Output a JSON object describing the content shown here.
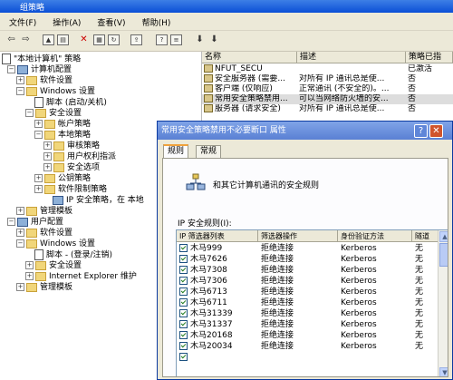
{
  "window": {
    "title": "组策略"
  },
  "menu": [
    "文件(F)",
    "操作(A)",
    "查看(V)",
    "帮助(H)"
  ],
  "toolbar": {
    "icons": [
      "back-arrow-icon",
      "forward-arrow-icon",
      "up-folder-icon",
      "show-tree-icon",
      "delete-icon",
      "properties-icon",
      "refresh-icon",
      "export-icon",
      "help-icon",
      "filter-icon",
      "assign-icon",
      "unassign-icon"
    ]
  },
  "tree": {
    "root": "\"本地计算机\" 策略",
    "computer_config": "计算机配置",
    "software_settings": "软件设置",
    "windows_settings": "Windows 设置",
    "scripts_startup": "脚本 (启动/关机)",
    "security_settings": "安全设置",
    "account_policies": "帐户策略",
    "local_policies": "本地策略",
    "audit_policy": "审核策略",
    "user_rights": "用户权利指派",
    "security_options": "安全选项",
    "public_key": "公钥策略",
    "software_restriction": "软件限制策略",
    "ip_security": "IP 安全策略，在 本地",
    "admin_templates": "管理模板",
    "user_config": "用户配置",
    "u_software_settings": "软件设置",
    "u_windows_settings": "Windows 设置",
    "u_scripts_logon": "脚本 - (登录/注销)",
    "u_security_settings": "安全设置",
    "u_ie_maintenance": "Internet Explorer 维护",
    "u_admin_templates": "管理模板"
  },
  "policy_list": {
    "headers": [
      "名称",
      "描述",
      "策略已指"
    ],
    "rows": [
      {
        "name": "NFUT_SECU",
        "desc": "",
        "assigned": "已激活"
      },
      {
        "name": "安全服务器 (需要...",
        "desc": "对所有 IP 通讯总是使...",
        "assigned": "否"
      },
      {
        "name": "客户端 (仅响应)",
        "desc": "正常通讯 (不安全的)。...",
        "assigned": "否"
      },
      {
        "name": "常用安全策略禁用...",
        "desc": "可以当网络防火墙的安...",
        "assigned": "否"
      },
      {
        "name": "服务器 (请求安全)",
        "desc": "对所有 IP 通讯总是使...",
        "assigned": "否"
      }
    ]
  },
  "dialog": {
    "title": "常用安全策略禁用不必要断口 属性",
    "help_button": "?",
    "close_button": "✕",
    "tabs": [
      "规则",
      "常规"
    ],
    "description": "和其它计算机通讯的安全规则",
    "rules_label": "IP 安全规则(I):",
    "columns": [
      "IP 筛选器列表",
      "筛选器操作",
      "身份验证方法",
      "隧道"
    ],
    "rules": [
      {
        "filter": "木马999",
        "action": "拒绝连接",
        "auth": "Kerberos",
        "tunnel": "无"
      },
      {
        "filter": "木马7626",
        "action": "拒绝连接",
        "auth": "Kerberos",
        "tunnel": "无"
      },
      {
        "filter": "木马7308",
        "action": "拒绝连接",
        "auth": "Kerberos",
        "tunnel": "无"
      },
      {
        "filter": "木马7306",
        "action": "拒绝连接",
        "auth": "Kerberos",
        "tunnel": "无"
      },
      {
        "filter": "木马6713",
        "action": "拒绝连接",
        "auth": "Kerberos",
        "tunnel": "无"
      },
      {
        "filter": "木马6711",
        "action": "拒绝连接",
        "auth": "Kerberos",
        "tunnel": "无"
      },
      {
        "filter": "木马31339",
        "action": "拒绝连接",
        "auth": "Kerberos",
        "tunnel": "无"
      },
      {
        "filter": "木马31337",
        "action": "拒绝连接",
        "auth": "Kerberos",
        "tunnel": "无"
      },
      {
        "filter": "木马20168",
        "action": "拒绝连接",
        "auth": "Kerberos",
        "tunnel": "无"
      },
      {
        "filter": "木马20034",
        "action": "拒绝连接",
        "auth": "Kerberos",
        "tunnel": "无"
      },
      {
        "filter": "",
        "action": "",
        "auth": "",
        "tunnel": ""
      }
    ]
  }
}
